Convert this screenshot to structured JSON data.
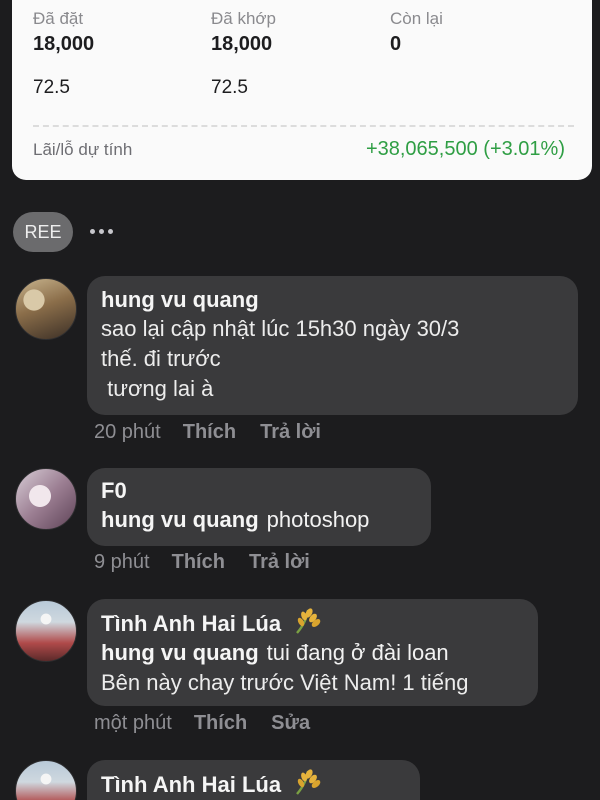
{
  "order": {
    "placed_label": "Đã đặt",
    "matched_label": "Đã khớp",
    "remaining_label": "Còn lại",
    "placed_qty": "18,000",
    "matched_qty": "18,000",
    "remaining_qty": "0",
    "placed_price": "72.5",
    "matched_price": "72.5",
    "pnl_label": "Lãi/lỗ dự tính",
    "pnl_value": "+38,065,500 (+3.01%)",
    "pnl_color": "#2f9e44"
  },
  "header": {
    "ticker": "REE",
    "more_icon": "more-horizontal-icon"
  },
  "comments": [
    {
      "author": "hung vu quang",
      "lines": [
        "sao lại cập nhật lúc 15h30 ngày 30/3",
        "thế. đi trước",
        " tương lai à"
      ],
      "time": "20 phút",
      "like": "Thích",
      "reply": "Trả lời"
    },
    {
      "author": "F0",
      "mention": "hung vu quang",
      "text": "photoshop",
      "time": "9 phút",
      "like": "Thích",
      "reply": "Trả lời"
    },
    {
      "author": "Tình Anh Hai Lúa",
      "badge_icon": "rice-plant-icon",
      "mention": "hung vu quang",
      "text": "tui đang ở đài loan",
      "text2": "Bên này chay trước Việt Nam! 1 tiếng",
      "time": "một phút",
      "like": "Thích",
      "edit": "Sửa"
    },
    {
      "author": "Tình Anh Hai Lúa",
      "badge_icon": "rice-plant-icon"
    }
  ]
}
